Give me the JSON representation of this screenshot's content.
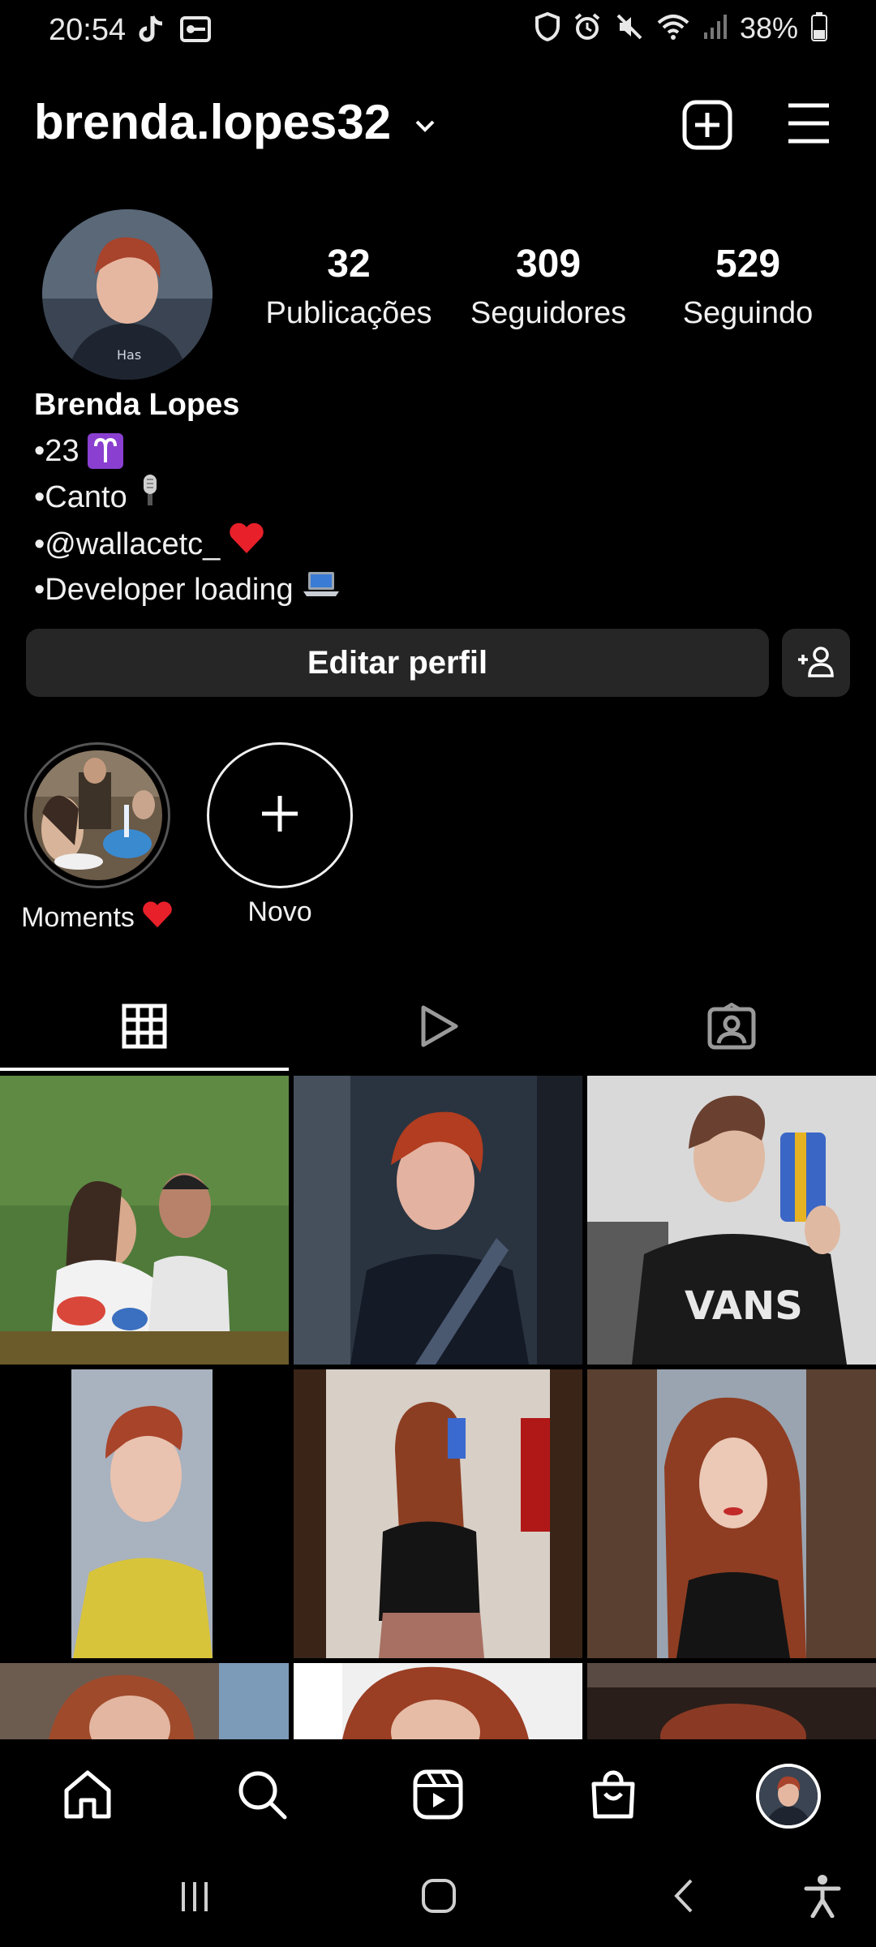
{
  "status_bar": {
    "time": "20:54",
    "battery": "38%",
    "icons_left": [
      "tiktok-icon",
      "key-icon"
    ],
    "icons_right": [
      "shield-icon",
      "alarm-icon",
      "mute-icon",
      "wifi-icon",
      "signal-icon",
      "battery-icon"
    ]
  },
  "header": {
    "username": "brenda.lopes32",
    "icons": [
      "chevron-down-icon",
      "add-post-icon",
      "menu-icon"
    ]
  },
  "stats": {
    "posts": {
      "value": "32",
      "label": "Publicações"
    },
    "followers": {
      "value": "309",
      "label": "Seguidores"
    },
    "following": {
      "value": "529",
      "label": "Seguindo"
    }
  },
  "bio": {
    "name": "Brenda Lopes",
    "lines": [
      {
        "text": "•23",
        "emoji": "aries-emoji"
      },
      {
        "text": "•Canto",
        "emoji": "microphone-emoji"
      },
      {
        "text": "•@wallacetc_",
        "emoji": "red-heart-emoji"
      },
      {
        "text": "•Developer loading",
        "emoji": "laptop-emoji"
      }
    ]
  },
  "actions": {
    "edit_profile": "Editar perfil"
  },
  "highlights": [
    {
      "label": "Moments",
      "emoji": "red-heart-emoji"
    },
    {
      "label": "Novo"
    }
  ],
  "tabs": [
    "grid-icon",
    "reels-icon",
    "tagged-icon"
  ],
  "bottom_nav": [
    "home-icon",
    "search-icon",
    "reels-icon",
    "shop-icon",
    "profile-avatar"
  ],
  "system_nav": [
    "recents-icon",
    "home-circle-icon",
    "back-icon",
    "accessibility-icon"
  ],
  "colors": {
    "background": "#000000",
    "button": "#262626",
    "text": "#f5f5f5"
  }
}
